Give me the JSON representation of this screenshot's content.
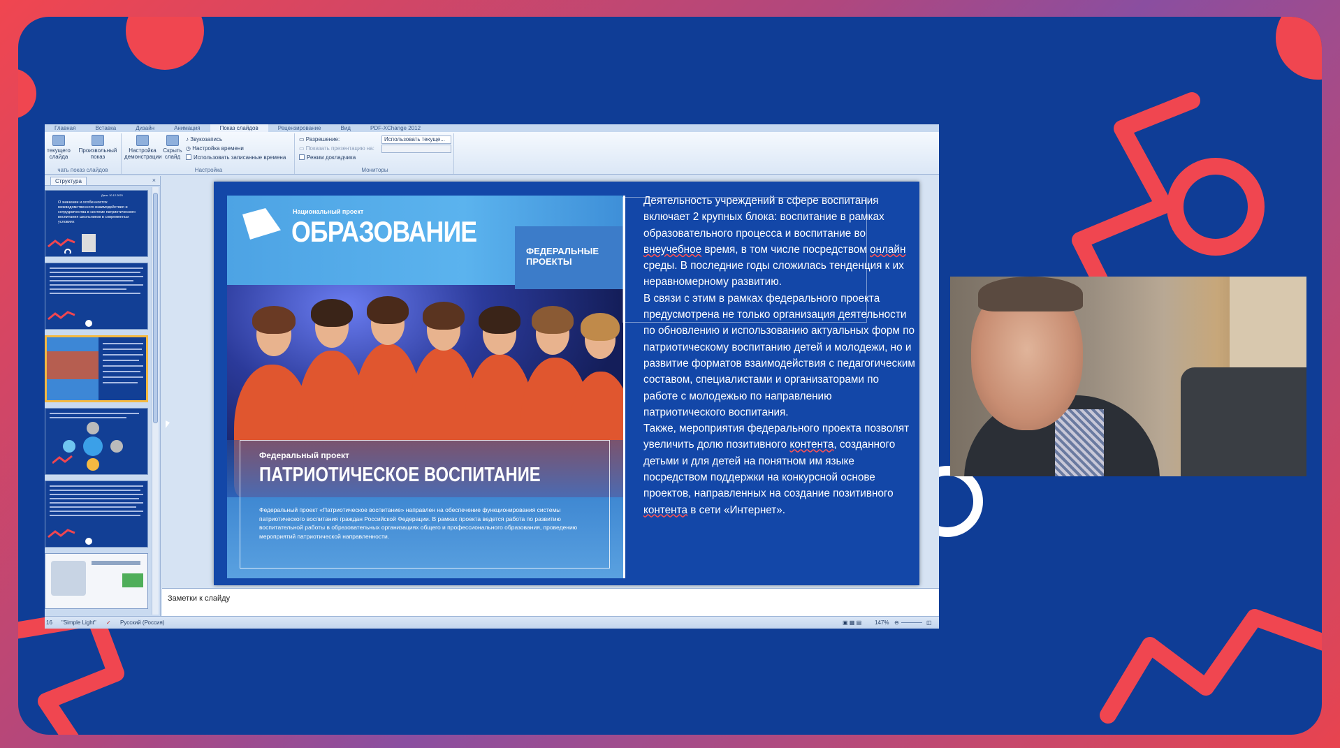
{
  "ribbon": {
    "tabs": [
      "Главная",
      "Вставка",
      "Дизайн",
      "Анимация",
      "Показ слайдов",
      "Рецензирование",
      "Вид",
      "PDF-XChange 2012"
    ],
    "active_tab_index": 4,
    "buttons": {
      "from_current": "текущего слайда",
      "custom_show": "Произвольный показ",
      "setup_show": "Настройка демонстрации",
      "hide_slide": "Скрыть слайд"
    },
    "rows": {
      "record_narration": "Звукозапись",
      "rehearse_timings": "Настройка времени",
      "use_timings": "Использовать записанные времена",
      "resolution": "Разрешение:",
      "show_on": "Показать презентацию на:",
      "presenter_view": "Режим докладчика"
    },
    "resolution_value": "Использовать текуще...",
    "groups": {
      "start": "чать показ слайдов",
      "setup": "Настройка",
      "monitors": "Мониторы"
    }
  },
  "left_pane": {
    "tab": "Структура",
    "close": "×",
    "thumb1_date": "Дата: 10.12.2021",
    "thumb1_title": "О значении и особенностях межведомственного взаимодействия и сотрудничества в системе патриотического воспитания школьников в современных условиях"
  },
  "slide": {
    "national_project": "Национальный проект",
    "education": "ОБРАЗОВАНИЕ",
    "federal_projects": "ФЕДЕРАЛЬНЫЕ ПРОЕКТЫ",
    "federal_project_label": "Федеральный проект",
    "patriotic": "ПАТРИОТИЧЕСКОЕ ВОСПИТАНИЕ",
    "patriotic_body": "Федеральный проект «Патриотическое воспитание» направлен на обеспечение функционирования системы патриотического воспитания граждан Российской Федерации. В рамках проекта ведется работа по развитию воспитательной работы в образовательных организациях общего и профессионального образования, проведению мероприятий патриотической направленности.",
    "text_p1": "Деятельность учреждений в сфере воспитания включает 2 крупных блока: воспитание в рамках образовательного процесса и воспитание во ",
    "text_p1_u1": "внеучебное",
    "text_p1_b": " время, в том числе посредством ",
    "text_p1_u2": "онлайн",
    "text_p1_c": " среды. В последние годы сложилась тенденция к их неравномерному развитию.",
    "text_p2": "В связи с этим в рамках федерального проекта предусмотрена не только организация деятельности по обновлению и использованию актуальных форм по патриотическому воспитанию детей и молодежи, но и развитие форматов взаимодействия с педагогическим составом, специалистами и организаторами по работе с молодежью по направлению патриотического воспитания.",
    "text_p3": "Также, мероприятия федерального проекта позволят увеличить долю позитивного ",
    "text_p3_u1": "контента",
    "text_p3_b": ", созданного детьми и для детей на понятном им языке посредством поддержки на конкурсной основе проектов, направленных на создание позитивного ",
    "text_p3_u2": "контента",
    "text_p3_c": " в сети «Интернет»."
  },
  "notes": {
    "placeholder": "Заметки к слайду"
  },
  "status": {
    "slide_num": "16",
    "theme": "\"Simple Light\"",
    "language": "Русский (Россия)",
    "zoom": "147%"
  }
}
